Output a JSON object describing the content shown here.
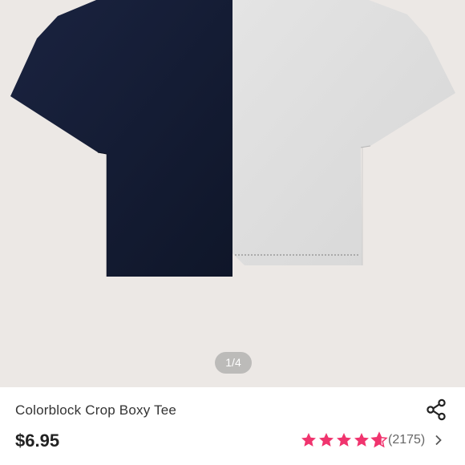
{
  "product": {
    "title": "Colorblock Crop Boxy Tee",
    "price": "$6.95",
    "rating": 4.7,
    "review_count": "(2175)",
    "image_pager": "1/4"
  },
  "colors": {
    "image_background": "#ece8e5",
    "navy_panel": "#141c33",
    "heather_grey_panel": "#dedede",
    "star_pink": "#f0346e",
    "price_text": "#222222"
  },
  "icons": {
    "share": "share-icon",
    "chevron": "chevron-right-icon",
    "star": "star-icon"
  }
}
